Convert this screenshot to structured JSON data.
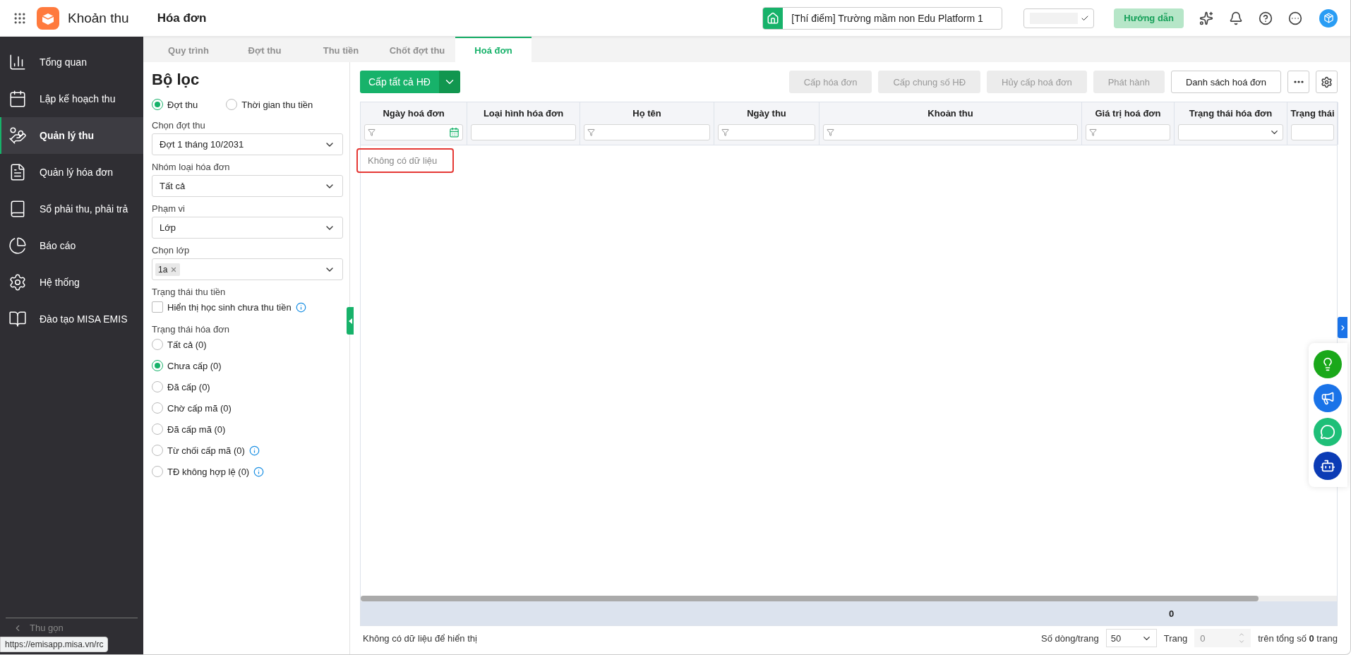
{
  "app": {
    "name": "Khoản thu",
    "page": "Hóa đơn"
  },
  "topbar": {
    "school": "[Thí điểm] Trường mầm non Edu Platform 1",
    "guide_button": "Hướng dẫn"
  },
  "sidebar": {
    "items": [
      {
        "label": "Tổng quan",
        "kind": "chart",
        "selected": false
      },
      {
        "label": "Lập kế hoạch thu",
        "kind": "calendar",
        "selected": false
      },
      {
        "label": "Quản lý thu",
        "kind": "coins",
        "selected": true
      },
      {
        "label": "Quản lý hóa đơn",
        "kind": "document",
        "selected": false
      },
      {
        "label": "Sổ phải thu, phải trả",
        "kind": "ledger",
        "selected": false
      },
      {
        "label": "Báo cáo",
        "kind": "pie",
        "selected": false
      },
      {
        "label": "Hệ thống",
        "kind": "gear",
        "selected": false
      },
      {
        "label": "Đào tạo MISA EMIS",
        "kind": "book",
        "selected": false
      }
    ],
    "collapse": "Thu gọn"
  },
  "tabs": [
    {
      "label": "Quy trình",
      "selected": false
    },
    {
      "label": "Đợt thu",
      "selected": false
    },
    {
      "label": "Thu tiền",
      "selected": false
    },
    {
      "label": "Chốt đợt thu",
      "selected": false
    },
    {
      "label": "Hoá đơn",
      "selected": true
    }
  ],
  "filter": {
    "title": "Bộ lọc",
    "mode_options": [
      {
        "label": "Đợt thu",
        "selected": true
      },
      {
        "label": "Thời gian thu tiền",
        "selected": false
      }
    ],
    "selects": [
      {
        "label": "Chọn đợt thu",
        "value": "Đợt 1 tháng 10/2031"
      },
      {
        "label": "Nhóm loại hóa đơn",
        "value": "Tất cả"
      },
      {
        "label": "Phạm vi",
        "value": "Lớp"
      },
      {
        "label": "Chọn lớp",
        "tags": [
          "1a"
        ]
      }
    ],
    "payment_status": {
      "label": "Trạng thái thu tiền",
      "checkbox_label": "Hiển thị học sinh chưa thu tiền",
      "checked": false,
      "info": true
    },
    "invoice_status": {
      "label": "Trạng thái hóa đơn",
      "options": [
        {
          "label": "Tất cả (0)",
          "selected": false,
          "info": false
        },
        {
          "label": "Chưa cấp (0)",
          "selected": true,
          "info": false
        },
        {
          "label": "Đã cấp (0)",
          "selected": false,
          "info": false
        },
        {
          "label": "Chờ cấp mã (0)",
          "selected": false,
          "info": false
        },
        {
          "label": "Đã cấp mã (0)",
          "selected": false,
          "info": false
        },
        {
          "label": "Từ chối cấp mã (0)",
          "selected": false,
          "info": true
        },
        {
          "label": "TĐ không hợp lệ (0)",
          "selected": false,
          "info": true
        }
      ]
    }
  },
  "toolbar": {
    "primary_button": "Cấp tất cả HĐ",
    "actions": [
      {
        "label": "Cấp hóa đơn",
        "disabled": true
      },
      {
        "label": "Cấp chung số HĐ",
        "disabled": true
      },
      {
        "label": "Hủy cấp hoá đơn",
        "disabled": true
      },
      {
        "label": "Phát hành",
        "disabled": true
      },
      {
        "label": "Danh sách hoá đơn",
        "disabled": false
      }
    ]
  },
  "table": {
    "columns": [
      {
        "label": "Ngày hoá đơn",
        "kind": "date"
      },
      {
        "label": "Loại hình hóa đơn",
        "kind": "text"
      },
      {
        "label": "Họ tên",
        "kind": "funnel"
      },
      {
        "label": "Ngày thu",
        "kind": "funnel"
      },
      {
        "label": "Khoản thu",
        "kind": "funnel"
      },
      {
        "label": "Giá trị hoá đơn",
        "kind": "funnel"
      },
      {
        "label": "Trạng thái hóa đơn",
        "kind": "select"
      },
      {
        "label": "Trạng thái",
        "kind": "text"
      }
    ],
    "empty_text": "Không có dữ liệu",
    "empty_highlighted": true,
    "summary_total": "0"
  },
  "footer": {
    "status": "Không có dữ liệu để hiển thị",
    "page_size_label": "Số dòng/trang",
    "page_size": "50",
    "page_label": "Trang",
    "page": "0",
    "total_text": "trên tổng số **0** trang"
  },
  "status_url": "https://emisapp.misa.vn/rc"
}
